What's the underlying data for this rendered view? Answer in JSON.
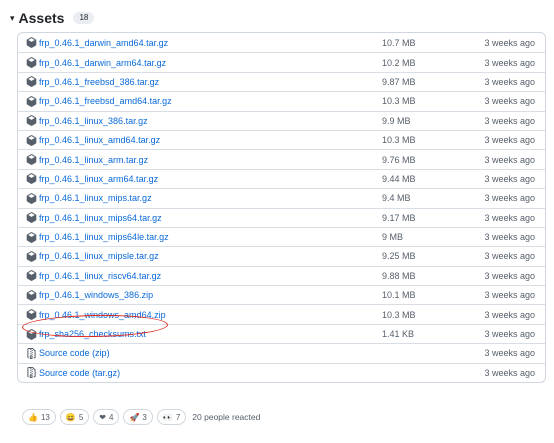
{
  "header": {
    "caret": "▾",
    "title": "Assets",
    "count": "18"
  },
  "assets": [
    {
      "icon": "package",
      "name": "frp_0.46.1_darwin_amd64.tar.gz",
      "size": "10.7 MB",
      "date": "3 weeks ago"
    },
    {
      "icon": "package",
      "name": "frp_0.46.1_darwin_arm64.tar.gz",
      "size": "10.2 MB",
      "date": "3 weeks ago"
    },
    {
      "icon": "package",
      "name": "frp_0.46.1_freebsd_386.tar.gz",
      "size": "9.87 MB",
      "date": "3 weeks ago"
    },
    {
      "icon": "package",
      "name": "frp_0.46.1_freebsd_amd64.tar.gz",
      "size": "10.3 MB",
      "date": "3 weeks ago"
    },
    {
      "icon": "package",
      "name": "frp_0.46.1_linux_386.tar.gz",
      "size": "9.9 MB",
      "date": "3 weeks ago"
    },
    {
      "icon": "package",
      "name": "frp_0.46.1_linux_amd64.tar.gz",
      "size": "10.3 MB",
      "date": "3 weeks ago"
    },
    {
      "icon": "package",
      "name": "frp_0.46.1_linux_arm.tar.gz",
      "size": "9.76 MB",
      "date": "3 weeks ago"
    },
    {
      "icon": "package",
      "name": "frp_0.46.1_linux_arm64.tar.gz",
      "size": "9.44 MB",
      "date": "3 weeks ago"
    },
    {
      "icon": "package",
      "name": "frp_0.46.1_linux_mips.tar.gz",
      "size": "9.4 MB",
      "date": "3 weeks ago"
    },
    {
      "icon": "package",
      "name": "frp_0.46.1_linux_mips64.tar.gz",
      "size": "9.17 MB",
      "date": "3 weeks ago"
    },
    {
      "icon": "package",
      "name": "frp_0.46.1_linux_mips64le.tar.gz",
      "size": "9 MB",
      "date": "3 weeks ago"
    },
    {
      "icon": "package",
      "name": "frp_0.46.1_linux_mipsle.tar.gz",
      "size": "9.25 MB",
      "date": "3 weeks ago"
    },
    {
      "icon": "package",
      "name": "frp_0.46.1_linux_riscv64.tar.gz",
      "size": "9.88 MB",
      "date": "3 weeks ago"
    },
    {
      "icon": "package",
      "name": "frp_0.46.1_windows_386.zip",
      "size": "10.1 MB",
      "date": "3 weeks ago"
    },
    {
      "icon": "package",
      "name": "frp_0.46.1_windows_amd64.zip",
      "size": "10.3 MB",
      "date": "3 weeks ago",
      "highlighted": true
    },
    {
      "icon": "package",
      "name": "frp_sha256_checksums.txt",
      "size": "1.41 KB",
      "date": "3 weeks ago"
    },
    {
      "icon": "file-zip",
      "name": "Source code",
      "suffix": "(zip)",
      "size": "",
      "date": "3 weeks ago"
    },
    {
      "icon": "file-zip",
      "name": "Source code",
      "suffix": "(tar.gz)",
      "size": "",
      "date": "3 weeks ago"
    }
  ],
  "annotation": {
    "color": "#e0281e"
  },
  "reactions": {
    "items": [
      {
        "emoji": "👍",
        "name": "thumbs-up",
        "count": "13"
      },
      {
        "emoji": "😄",
        "name": "smile",
        "count": "5"
      },
      {
        "emoji": "❤",
        "name": "heart",
        "count": "4"
      },
      {
        "emoji": "🚀",
        "name": "rocket",
        "count": "3"
      },
      {
        "emoji": "👀",
        "name": "eyes",
        "count": "7"
      }
    ],
    "summary": "20 people reacted"
  },
  "colors": {
    "link": "#0969da",
    "muted": "#57606a",
    "border": "#d0d7de"
  }
}
